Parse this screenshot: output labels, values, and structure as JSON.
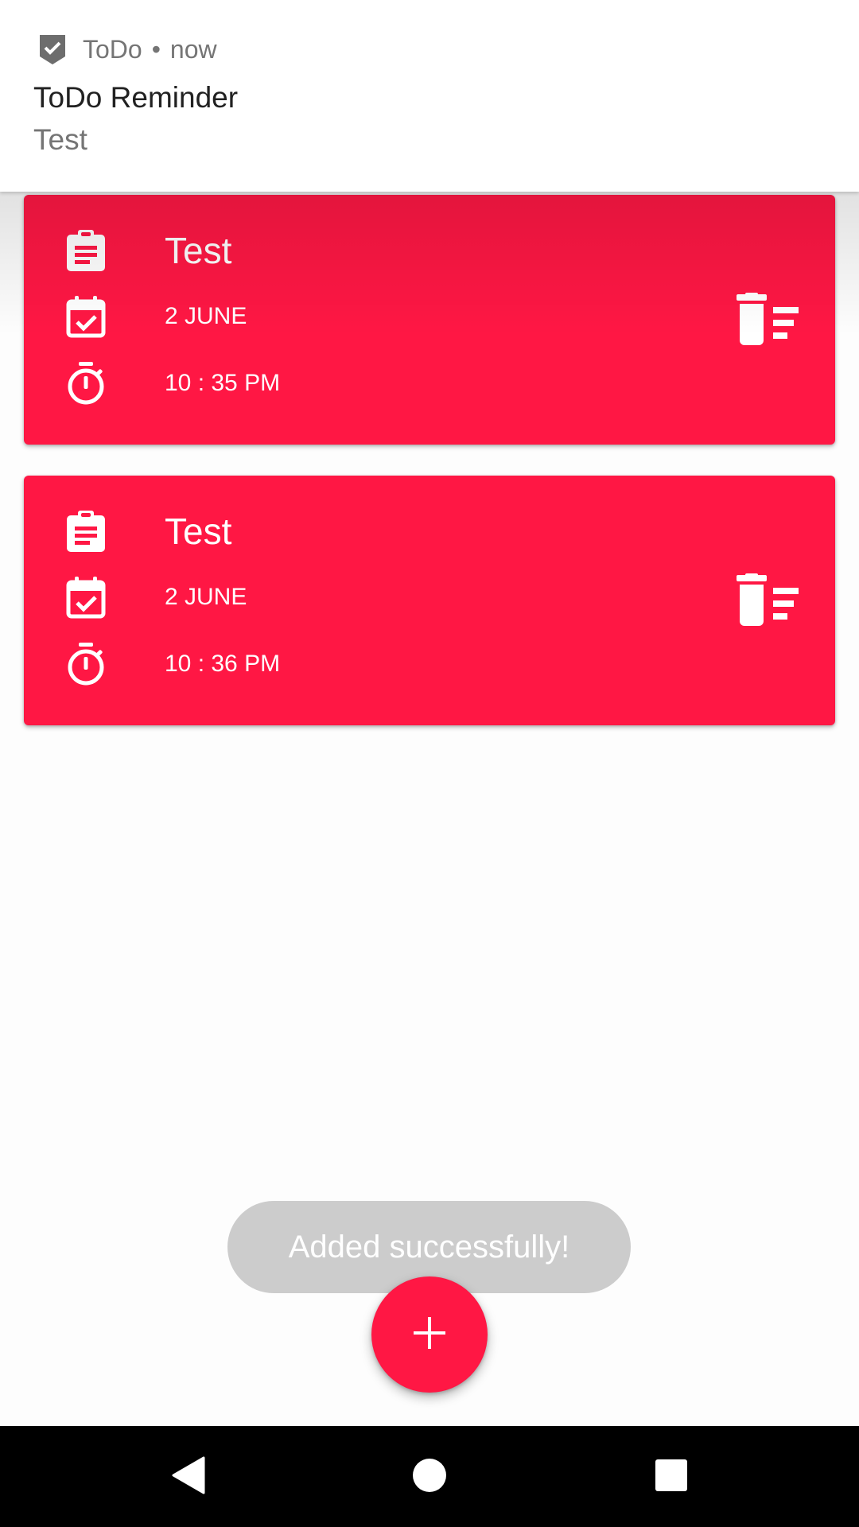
{
  "notification": {
    "app_name": "ToDo",
    "separator": "•",
    "time": "now",
    "title": "ToDo Reminder",
    "text": "Test",
    "icon": "check-shield-icon"
  },
  "todos": [
    {
      "title": "Test",
      "date": "2 JUNE",
      "time": "10 : 35 PM"
    },
    {
      "title": "Test",
      "date": "2 JUNE",
      "time": "10 : 36 PM"
    }
  ],
  "toast": {
    "message": "Added successfully!"
  },
  "fab": {
    "icon": "plus-icon"
  },
  "navbar": {
    "back": "back-icon",
    "home": "home-icon",
    "recents": "recents-icon"
  },
  "colors": {
    "accent": "#ff1744",
    "toast_bg": "#c8c8c8",
    "notification_bg": "#ffffff",
    "navbar_bg": "#000000"
  }
}
